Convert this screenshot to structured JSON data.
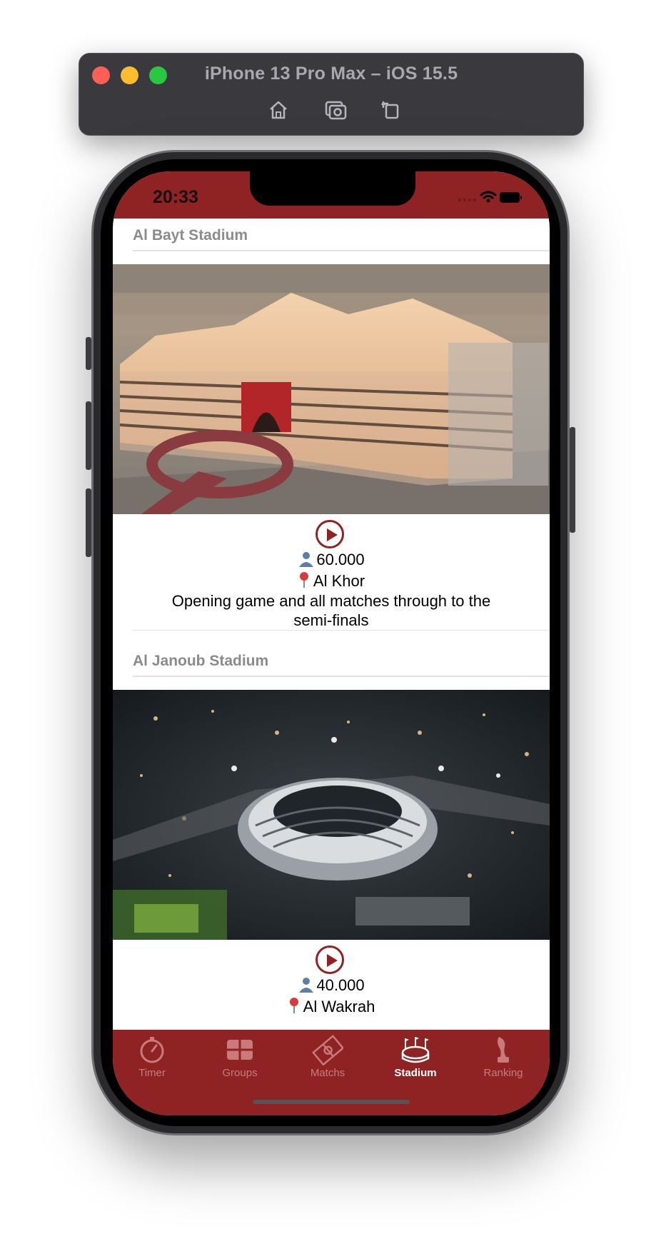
{
  "simulator": {
    "title": "iPhone 13 Pro Max – iOS 15.5",
    "tools": [
      "home-icon",
      "screenshot-icon",
      "rotate-icon"
    ]
  },
  "status_bar": {
    "time": "20:33"
  },
  "stadiums": [
    {
      "name": "Al Bayt Stadium",
      "capacity": "60.000",
      "city": "Al Khor",
      "description": "Opening game and all matches through to the semi-finals"
    },
    {
      "name": "Al Janoub Stadium",
      "capacity": "40.000",
      "city": "Al Wakrah"
    }
  ],
  "tabs": [
    {
      "label": "Timer",
      "icon": "stopwatch-icon"
    },
    {
      "label": "Groups",
      "icon": "grid-icon"
    },
    {
      "label": "Matchs",
      "icon": "pitch-icon"
    },
    {
      "label": "Stadium",
      "icon": "stadium-icon",
      "active": true
    },
    {
      "label": "Ranking",
      "icon": "trophy-icon"
    }
  ],
  "colors": {
    "brand": "#8f2324",
    "tab_inactive": "#c97a7b",
    "tab_active": "#ffffff"
  }
}
